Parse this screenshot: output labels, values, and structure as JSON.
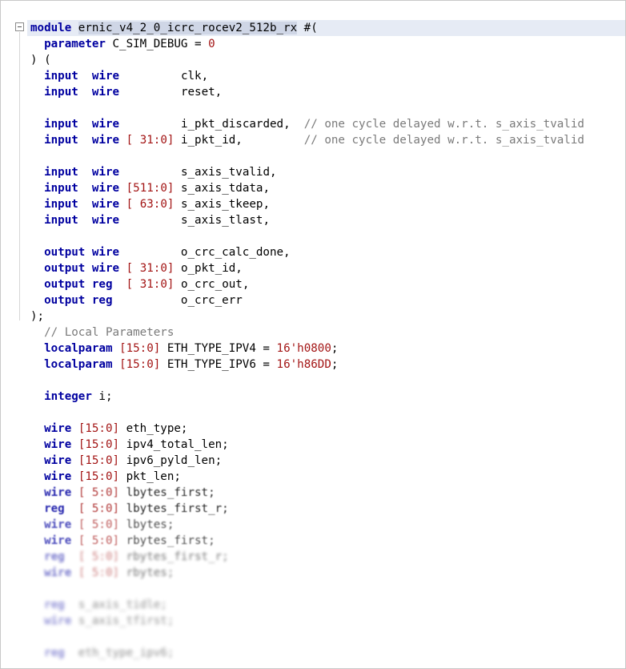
{
  "editor": {
    "lines": [
      [
        {
          "t": "module",
          "c": "kw"
        },
        {
          "t": " "
        },
        {
          "t": "ernic_v4_2_0_icrc_rocev2_512b_rx",
          "c": "hl-word"
        },
        {
          "t": " #("
        }
      ],
      [
        {
          "t": "  "
        },
        {
          "t": "parameter",
          "c": "kw"
        },
        {
          "t": " C_SIM_DEBUG = "
        },
        {
          "t": "0",
          "c": "num"
        }
      ],
      [
        {
          "t": ") ("
        }
      ],
      [
        {
          "t": "  "
        },
        {
          "t": "input",
          "c": "kw"
        },
        {
          "t": "  "
        },
        {
          "t": "wire",
          "c": "kw"
        },
        {
          "t": "         clk,"
        }
      ],
      [
        {
          "t": "  "
        },
        {
          "t": "input",
          "c": "kw"
        },
        {
          "t": "  "
        },
        {
          "t": "wire",
          "c": "kw"
        },
        {
          "t": "         reset,"
        }
      ],
      [],
      [
        {
          "t": "  "
        },
        {
          "t": "input",
          "c": "kw"
        },
        {
          "t": "  "
        },
        {
          "t": "wire",
          "c": "kw"
        },
        {
          "t": "         i_pkt_discarded,  "
        },
        {
          "t": "// one cycle delayed w.r.t. s_axis_tvalid",
          "c": "cmt"
        }
      ],
      [
        {
          "t": "  "
        },
        {
          "t": "input",
          "c": "kw"
        },
        {
          "t": "  "
        },
        {
          "t": "wire",
          "c": "kw"
        },
        {
          "t": " "
        },
        {
          "t": "[ 31:0]",
          "c": "num"
        },
        {
          "t": " i_pkt_id,         "
        },
        {
          "t": "// one cycle delayed w.r.t. s_axis_tvalid",
          "c": "cmt"
        }
      ],
      [],
      [
        {
          "t": "  "
        },
        {
          "t": "input",
          "c": "kw"
        },
        {
          "t": "  "
        },
        {
          "t": "wire",
          "c": "kw"
        },
        {
          "t": "         s_axis_tvalid,"
        }
      ],
      [
        {
          "t": "  "
        },
        {
          "t": "input",
          "c": "kw"
        },
        {
          "t": "  "
        },
        {
          "t": "wire",
          "c": "kw"
        },
        {
          "t": " "
        },
        {
          "t": "[511:0]",
          "c": "num"
        },
        {
          "t": " s_axis_tdata,"
        }
      ],
      [
        {
          "t": "  "
        },
        {
          "t": "input",
          "c": "kw"
        },
        {
          "t": "  "
        },
        {
          "t": "wire",
          "c": "kw"
        },
        {
          "t": " "
        },
        {
          "t": "[ 63:0]",
          "c": "num"
        },
        {
          "t": " s_axis_tkeep,"
        }
      ],
      [
        {
          "t": "  "
        },
        {
          "t": "input",
          "c": "kw"
        },
        {
          "t": "  "
        },
        {
          "t": "wire",
          "c": "kw"
        },
        {
          "t": "         s_axis_tlast,"
        }
      ],
      [],
      [
        {
          "t": "  "
        },
        {
          "t": "output",
          "c": "kw"
        },
        {
          "t": " "
        },
        {
          "t": "wire",
          "c": "kw"
        },
        {
          "t": "         o_crc_calc_done,"
        }
      ],
      [
        {
          "t": "  "
        },
        {
          "t": "output",
          "c": "kw"
        },
        {
          "t": " "
        },
        {
          "t": "wire",
          "c": "kw"
        },
        {
          "t": " "
        },
        {
          "t": "[ 31:0]",
          "c": "num"
        },
        {
          "t": " o_pkt_id,"
        }
      ],
      [
        {
          "t": "  "
        },
        {
          "t": "output",
          "c": "kw"
        },
        {
          "t": " "
        },
        {
          "t": "reg",
          "c": "kw"
        },
        {
          "t": "  "
        },
        {
          "t": "[ 31:0]",
          "c": "num"
        },
        {
          "t": " o_crc_out,"
        }
      ],
      [
        {
          "t": "  "
        },
        {
          "t": "output",
          "c": "kw"
        },
        {
          "t": " "
        },
        {
          "t": "reg",
          "c": "kw"
        },
        {
          "t": "          o_crc_err"
        }
      ],
      [
        {
          "t": ");"
        }
      ],
      [
        {
          "t": "  "
        },
        {
          "t": "// Local Parameters",
          "c": "cmt"
        }
      ],
      [
        {
          "t": "  "
        },
        {
          "t": "localparam",
          "c": "kw"
        },
        {
          "t": " "
        },
        {
          "t": "[15:0]",
          "c": "num"
        },
        {
          "t": " ETH_TYPE_IPV4 = "
        },
        {
          "t": "16'h0800",
          "c": "num"
        },
        {
          "t": ";"
        }
      ],
      [
        {
          "t": "  "
        },
        {
          "t": "localparam",
          "c": "kw"
        },
        {
          "t": " "
        },
        {
          "t": "[15:0]",
          "c": "num"
        },
        {
          "t": " ETH_TYPE_IPV6 = "
        },
        {
          "t": "16'h86DD",
          "c": "num"
        },
        {
          "t": ";"
        }
      ],
      [],
      [
        {
          "t": "  "
        },
        {
          "t": "integer",
          "c": "kw"
        },
        {
          "t": " i;"
        }
      ],
      [],
      [
        {
          "t": "  "
        },
        {
          "t": "wire",
          "c": "kw"
        },
        {
          "t": " "
        },
        {
          "t": "[15:0]",
          "c": "num"
        },
        {
          "t": " eth_type;"
        }
      ],
      [
        {
          "t": "  "
        },
        {
          "t": "wire",
          "c": "kw"
        },
        {
          "t": " "
        },
        {
          "t": "[15:0]",
          "c": "num"
        },
        {
          "t": " ipv4_total_len;"
        }
      ],
      [
        {
          "t": "  "
        },
        {
          "t": "wire",
          "c": "kw"
        },
        {
          "t": " "
        },
        {
          "t": "[15:0]",
          "c": "num"
        },
        {
          "t": " ipv6_pyld_len;"
        }
      ],
      [
        {
          "t": "  "
        },
        {
          "t": "wire",
          "c": "kw"
        },
        {
          "t": " "
        },
        {
          "t": "[15:0]",
          "c": "num"
        },
        {
          "t": " pkt_len;"
        }
      ],
      [
        {
          "t": "  "
        },
        {
          "t": "wire",
          "c": "kw"
        },
        {
          "t": " "
        },
        {
          "t": "[ 5:0]",
          "c": "num"
        },
        {
          "t": " lbytes_first;"
        }
      ],
      [
        {
          "t": "  "
        },
        {
          "t": "reg",
          "c": "kw"
        },
        {
          "t": "  "
        },
        {
          "t": "[ 5:0]",
          "c": "num"
        },
        {
          "t": " lbytes_first_r;"
        }
      ],
      [
        {
          "t": "  "
        },
        {
          "t": "wire",
          "c": "kw"
        },
        {
          "t": " "
        },
        {
          "t": "[ 5:0]",
          "c": "num"
        },
        {
          "t": " lbytes;"
        }
      ],
      [
        {
          "t": "  "
        },
        {
          "t": "wire",
          "c": "kw"
        },
        {
          "t": " "
        },
        {
          "t": "[ 5:0]",
          "c": "num"
        },
        {
          "t": " rbytes_first;"
        }
      ],
      [
        {
          "t": "  "
        },
        {
          "t": "reg",
          "c": "kw"
        },
        {
          "t": "  "
        },
        {
          "t": "[ 5:0]",
          "c": "num"
        },
        {
          "t": " rbytes_first_r;"
        }
      ],
      [
        {
          "t": "  "
        },
        {
          "t": "wire",
          "c": "kw"
        },
        {
          "t": " "
        },
        {
          "t": "[ 5:0]",
          "c": "num"
        },
        {
          "t": " rbytes;"
        }
      ],
      [],
      [
        {
          "t": "  "
        },
        {
          "t": "reg",
          "c": "kw"
        },
        {
          "t": "  s_axis_tidle;"
        }
      ],
      [
        {
          "t": "  "
        },
        {
          "t": "wire",
          "c": "kw"
        },
        {
          "t": " s_axis_tfirst;"
        }
      ],
      [],
      [
        {
          "t": "  "
        },
        {
          "t": "reg",
          "c": "kw"
        },
        {
          "t": "  eth_type_ipv6;"
        }
      ]
    ]
  }
}
